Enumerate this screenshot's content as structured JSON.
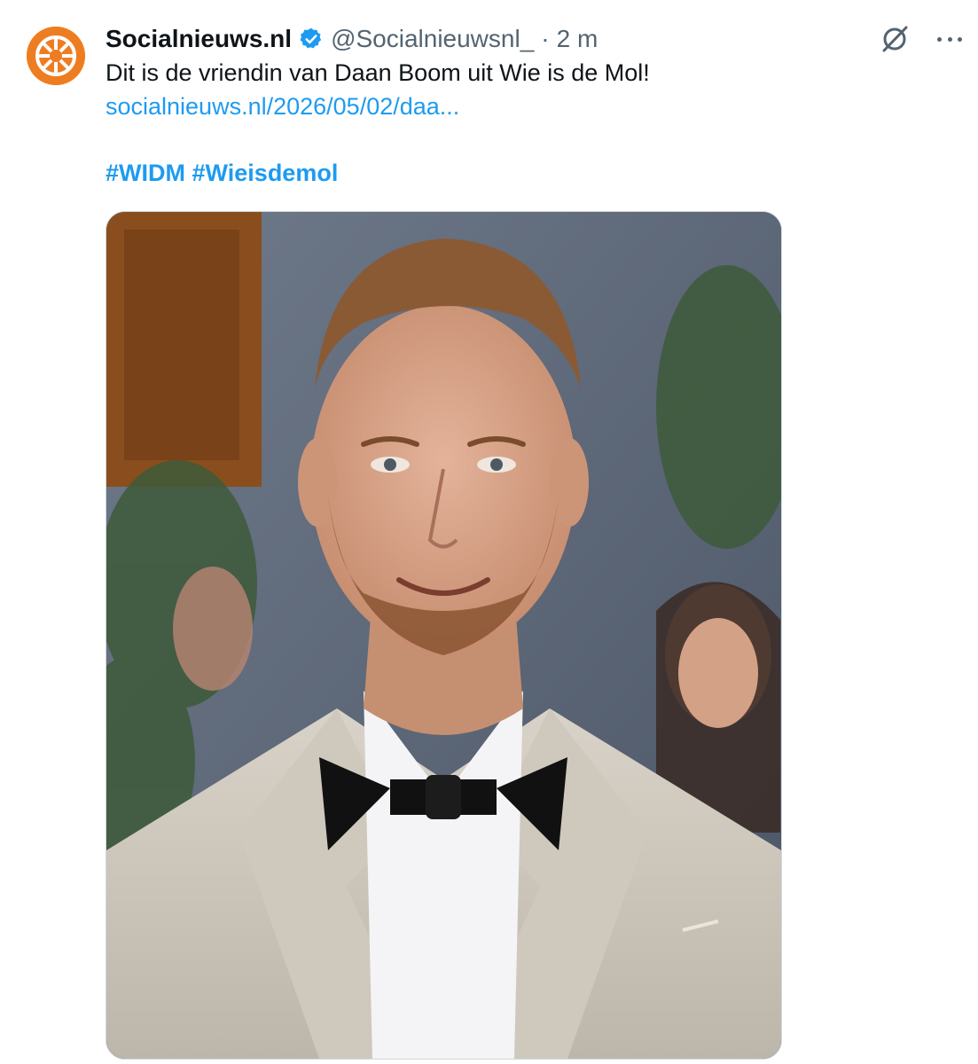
{
  "tweet": {
    "display_name": "Socialnieuws.nl",
    "handle": "@Socialnieuwsnl_",
    "separator": "·",
    "time": "2 m",
    "text": "Dit is de vriendin van Daan Boom uit Wie is de Mol!",
    "link": "socialnieuws.nl/2026/05/02/daa...",
    "hashtags": [
      "#WIDM",
      "#Wieisdemol"
    ]
  },
  "colors": {
    "brand_orange": "#ee7d22",
    "link_blue": "#1d9bf0",
    "verified_blue": "#1d9bf0",
    "secondary_text": "#536471"
  },
  "icons": {
    "verified": "verified-badge-icon",
    "grok": "grok-icon",
    "more": "more-options-icon"
  }
}
